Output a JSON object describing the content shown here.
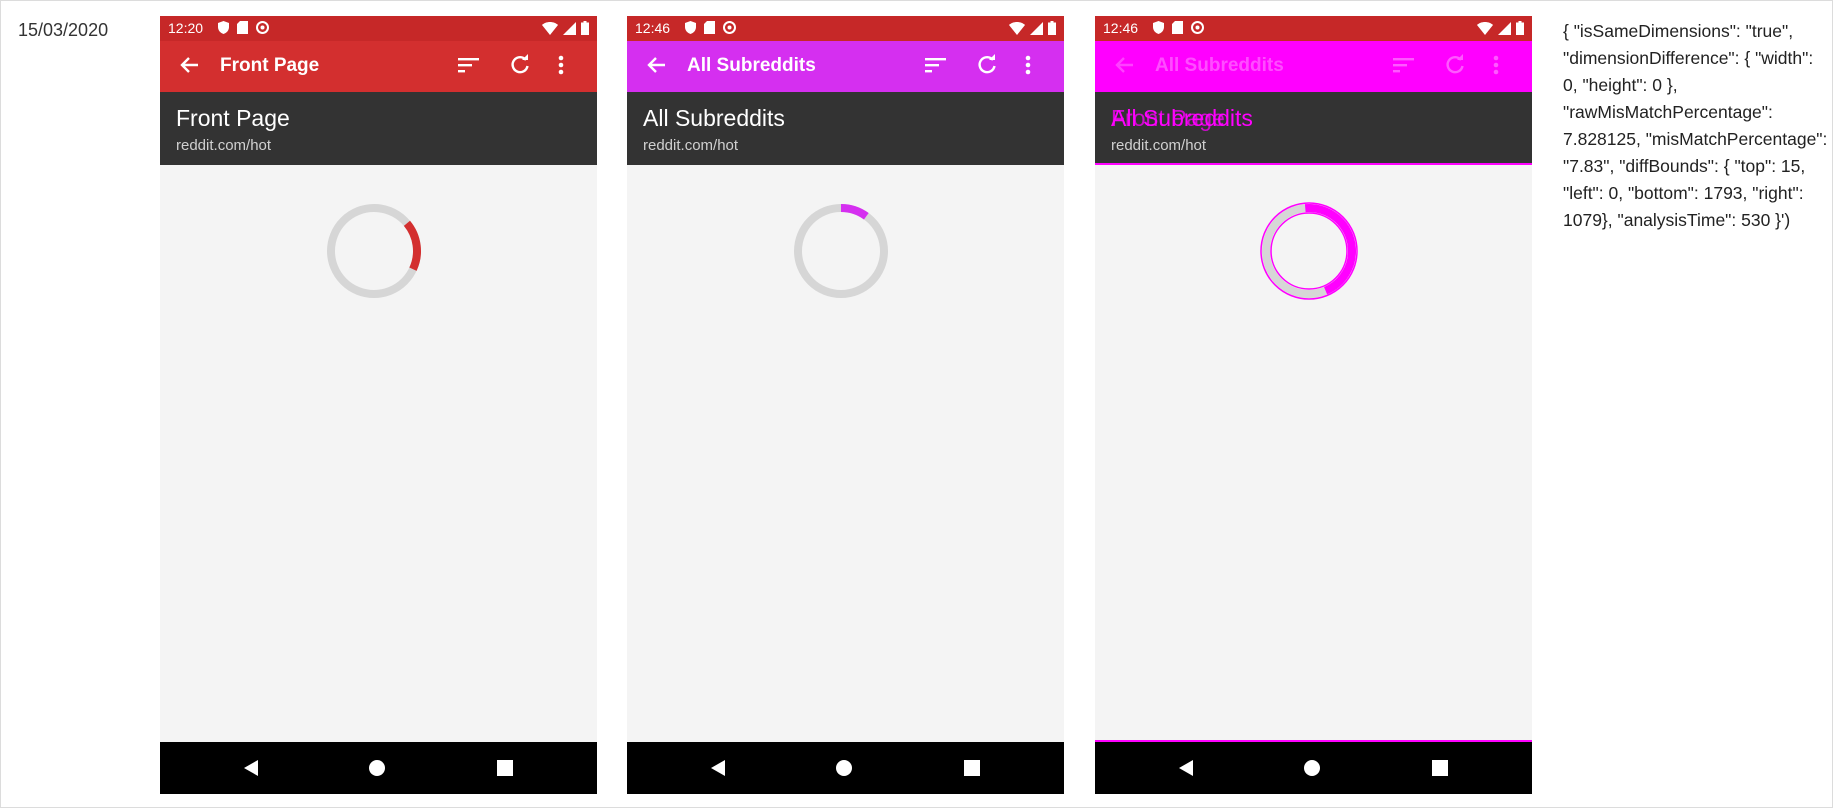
{
  "date": "15/03/2020",
  "colors": {
    "reddit_red": "#d32f2f",
    "purple": "#d52ff0",
    "magenta": "#ff00ff",
    "header_dark": "#333333",
    "content_bg": "#f4f4f4",
    "spinner_track": "#d6d6d6"
  },
  "screens": [
    {
      "time": "12:20",
      "title": "Front Page",
      "header_title": "Front Page",
      "header_sub": "reddit.com/hot",
      "accent": "#d32f2f",
      "progress": 0.18
    },
    {
      "time": "12:46",
      "title": "All Subreddits",
      "header_title": "All Subreddits",
      "header_sub": "reddit.com/hot",
      "accent": "#d52ff0",
      "progress": 0.1
    },
    {
      "time": "12:46",
      "title": "All Subreddits",
      "header_title": "All Subreddits",
      "header_title_overlay": "Front Page",
      "header_sub": "reddit.com/hot",
      "accent": "#ff00ff",
      "progress": 0.45
    }
  ],
  "icons": {
    "back": "arrow-left-icon",
    "sort": "sort-icon",
    "refresh": "refresh-icon",
    "more": "more-vert-icon",
    "nav_back": "nav-back-icon",
    "nav_home": "nav-home-icon",
    "nav_recent": "nav-recent-icon"
  },
  "diff_result": "{ \"isSameDimensions\": \"true\", \"dimensionDifference\": { \"width\": 0, \"height\": 0 }, \"rawMisMatchPercentage\": 7.828125, \"misMatchPercentage\": \"7.83\", \"diffBounds\": { \"top\": 15, \"left\": 0, \"bottom\": 1793, \"right\": 1079}, \"analysisTime\": 530 }')"
}
